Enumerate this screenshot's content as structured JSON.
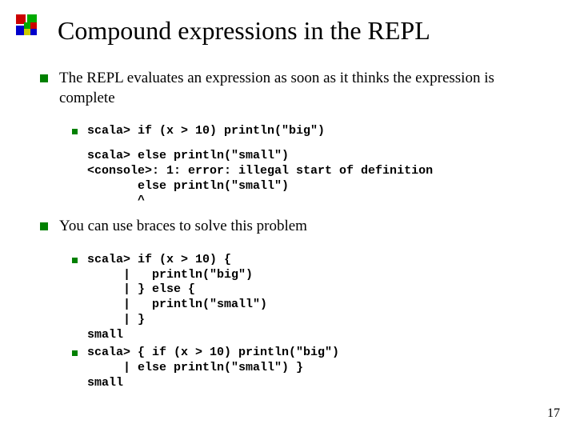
{
  "title": "Compound expressions in the REPL",
  "page_number": "17",
  "points": {
    "p1": "The REPL evaluates an expression as soon as it thinks the expression is complete",
    "p1_code1": "scala> if (x > 10) println(\"big\")",
    "p1_code2": "scala> else println(\"small\")\n<console>: 1: error: illegal start of definition\n       else println(\"small\")\n       ^",
    "p2": "You can use braces to solve this problem",
    "p2_code1": "scala> if (x > 10) {\n     |   println(\"big\")\n     | } else {\n     |   println(\"small\")\n     | }\nsmall",
    "p2_code2": "scala> { if (x > 10) println(\"big\")\n     | else println(\"small\") }\nsmall"
  }
}
